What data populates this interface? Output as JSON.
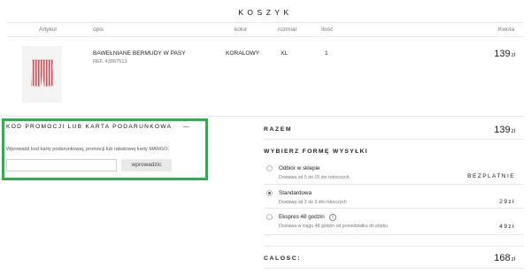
{
  "page": {
    "title": "KOSZYK"
  },
  "columns": {
    "artykul": "Artykul",
    "opis": "opis",
    "kolor": "kolor",
    "rozmiar": "rozmiar",
    "ilosc": "Ilość",
    "kwota": "Kwota"
  },
  "item": {
    "image_icon": "striped-shorts-image",
    "name": "BAWEŁNIANE BERMUDY W PASY",
    "ref": "REF. 43067513",
    "color": "KORALOWY",
    "size": "XL",
    "qty": "1",
    "price": "139",
    "currency": "zł"
  },
  "promo": {
    "title": "KOD PROMOCJI LUB KARTA PODARUNKOWA",
    "collapse_icon": "—",
    "description": "Wprowadź kod karty podarunkowej, promocji lub rabatowej karty MANGO.",
    "input_value": "",
    "button_label": "wprowadzic",
    "highlight_color": "#2db04b"
  },
  "summary": {
    "razem_label": "RAZEM",
    "razem_value": "139",
    "currency": "zł",
    "shipping_title": "WYBIERZ FORMĘ WYSYŁKI",
    "options": [
      {
        "label": "Odbiór w sklepie",
        "sub": "Dostawa od 5 do 15 dni roboczych",
        "price": "BEZPLATNIE",
        "selected": false
      },
      {
        "label": "Standardowa",
        "sub": "Dostawa od 2 do 3 dni roboczych",
        "price": "29zł",
        "selected": true
      },
      {
        "label": "Ekspres 48 godzin",
        "sub": "Dostawa w ciągu 48 godzin od poniedziałku do piątku",
        "price": "49zł",
        "selected": false,
        "info": "i"
      }
    ],
    "calosc_label": "CALOSC:",
    "calosc_value": "168"
  }
}
